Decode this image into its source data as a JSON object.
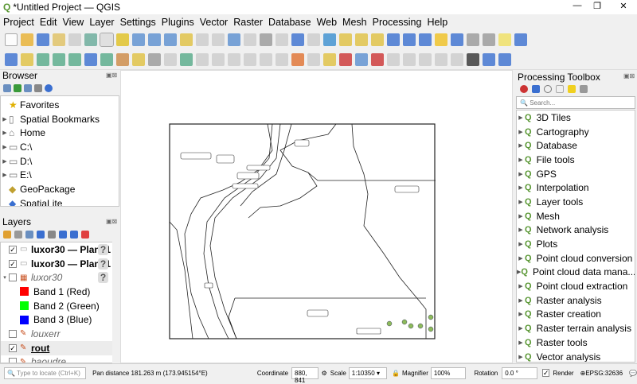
{
  "window": {
    "title": "*Untitled Project — QGIS"
  },
  "menu": [
    "Project",
    "Edit",
    "View",
    "Layer",
    "Settings",
    "Plugins",
    "Vector",
    "Raster",
    "Database",
    "Web",
    "Mesh",
    "Processing",
    "Help"
  ],
  "browser": {
    "title": "Browser",
    "items": [
      {
        "label": "Favorites",
        "icon": "star-icon"
      },
      {
        "label": "Spatial Bookmarks",
        "icon": "bookmark-icon"
      },
      {
        "label": "Home",
        "icon": "home-folder-icon"
      },
      {
        "label": "C:\\",
        "icon": "folder-icon"
      },
      {
        "label": "D:\\",
        "icon": "folder-icon"
      },
      {
        "label": "E:\\",
        "icon": "folder-icon"
      },
      {
        "label": "GeoPackage",
        "icon": "geopackage-icon"
      },
      {
        "label": "SpatiaLite",
        "icon": "spatialite-icon"
      }
    ]
  },
  "layers": {
    "title": "Layers",
    "items": [
      {
        "label": "luxor30 — Plan_1",
        "checked": true,
        "bold": true
      },
      {
        "label": "luxor30 — Plan_1",
        "checked": true,
        "bold": true
      },
      {
        "label": "luxor30",
        "checked": false,
        "italic": true
      },
      {
        "label": "Band 1 (Red)",
        "color": "#ff0000"
      },
      {
        "label": "Band 2 (Green)",
        "color": "#00ff00"
      },
      {
        "label": "Band 3 (Blue)",
        "color": "#0000ff"
      },
      {
        "label": "louxerr",
        "checked": false,
        "italic": true
      },
      {
        "label": "rout",
        "checked": true,
        "bold": true
      },
      {
        "label": "baoudre",
        "checked": false,
        "italic": true
      }
    ]
  },
  "toolbox": {
    "title": "Processing Toolbox",
    "search_placeholder": "Search...",
    "items": [
      "3D Tiles",
      "Cartography",
      "Database",
      "File tools",
      "GPS",
      "Interpolation",
      "Layer tools",
      "Mesh",
      "Network analysis",
      "Plots",
      "Point cloud conversion",
      "Point cloud data mana...",
      "Point cloud extraction",
      "Raster analysis",
      "Raster creation",
      "Raster terrain analysis",
      "Raster tools",
      "Vector analysis"
    ]
  },
  "status": {
    "locate_placeholder": "Type to locate (Ctrl+K)",
    "message": "Pan distance 181.263 m (173.945154°E)",
    "coordinate_label": "Coordinate",
    "coordinate": "880, 841",
    "scale_label": "Scale",
    "scale": "1:10350",
    "magnifier_label": "Magnifier",
    "magnifier": "100%",
    "rotation_label": "Rotation",
    "rotation": "0.0 °",
    "render_label": "Render",
    "render_checked": true,
    "crs": "EPSG:32636"
  },
  "colors": {
    "qgis_green": "#589632"
  }
}
